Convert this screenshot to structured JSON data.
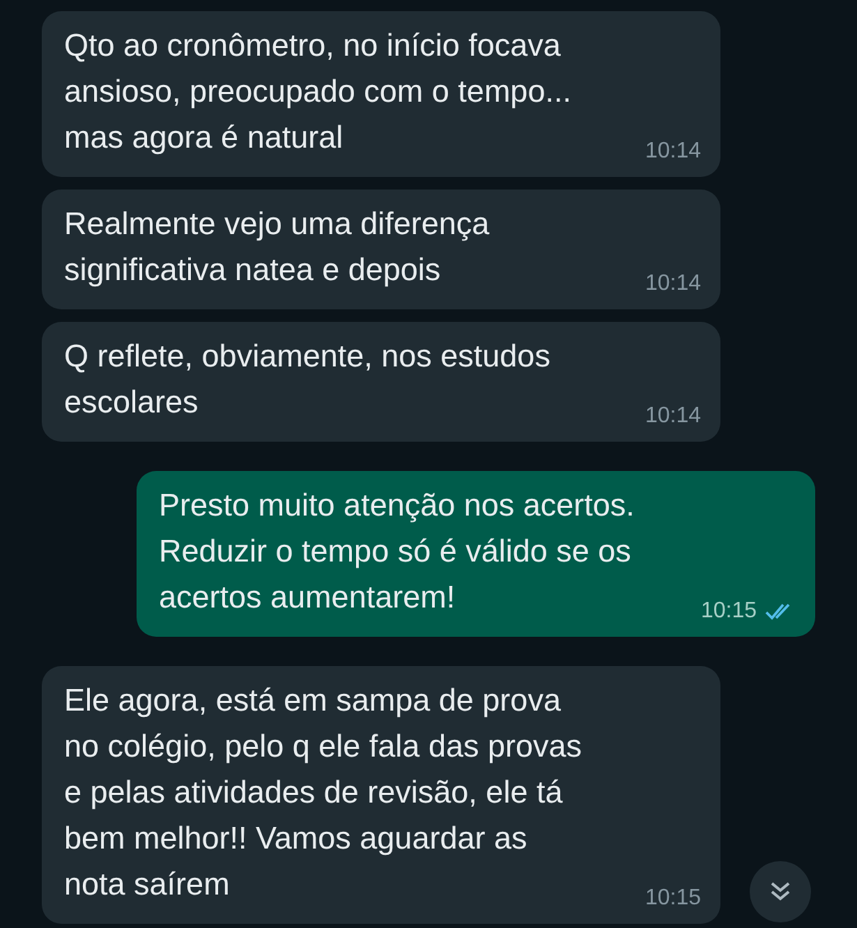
{
  "messages": [
    {
      "kind": "incoming",
      "text": "Qto ao cronômetro, no início focava\nansioso, preocupado com o tempo...\nmas agora é natural",
      "time": "10:14"
    },
    {
      "kind": "incoming",
      "text": "Realmente vejo uma diferença\nsignificativa natea e depois",
      "time": "10:14"
    },
    {
      "kind": "incoming",
      "text": "Q reflete, obviamente, nos estudos\nescolares",
      "time": "10:14"
    },
    {
      "kind": "outgoing",
      "text": "Presto muito atenção nos acertos.\nReduzir o tempo só é válido se os\nacertos aumentarem!",
      "time": "10:15",
      "read": true
    },
    {
      "kind": "incoming",
      "text": "Ele agora, está em sampa de prova\nno colégio, pelo q ele fala das provas\ne pelas atividades de revisão, ele tá\nbem melhor!! Vamos aguardar as\nnota saírem",
      "time": "10:15"
    }
  ]
}
